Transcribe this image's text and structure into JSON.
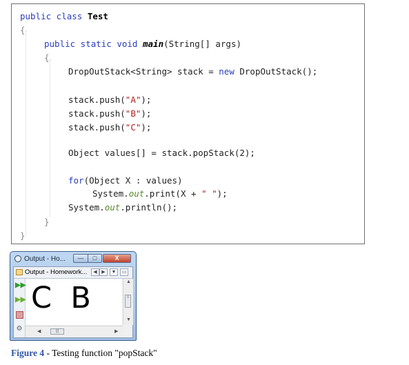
{
  "code": {
    "class_kw": "public class",
    "class_name": "Test",
    "open_brace": "{",
    "close_brace": "}",
    "main_kw": "public static void",
    "main_name": "main",
    "main_params": "(String[] args)",
    "decl_type": "DropOutStack<String> stack",
    "decl_eq": "=",
    "decl_new": "new",
    "decl_ctor": "DropOutStack();",
    "push_call": "stack.push(",
    "push_close": ");",
    "push_a": "\"A\"",
    "push_b": "\"B\"",
    "push_c": "\"C\"",
    "pop_stmt": "Object values[] = stack.popStack(2);",
    "for_kw": "for",
    "for_rest": "(Object X : values)",
    "print_prefix": "System.",
    "print_out": "out",
    "print_call": ".print(X + ",
    "print_str": "\" \"",
    "print_end": ");",
    "println_call": ".println();"
  },
  "output_window": {
    "title": "Output - Ho...",
    "tab_label": "Output - Homework...",
    "output_text": "C  B",
    "minimize_glyph": "—",
    "maximize_glyph": "□",
    "close_glyph": "X",
    "nav_left": "◀",
    "nav_right": "▶",
    "tab_menu_glyph": "▼",
    "tab_restore_glyph": "▭",
    "scroll_up": "▲",
    "scroll_down": "▼",
    "scroll_left": "◀",
    "scroll_right": "▶",
    "grip_v": "≡",
    "grip_h": "|||"
  },
  "caption": {
    "figure_label": "Figure 4",
    "text": " - Testing function \"popStack\""
  },
  "icons": [
    "rerun-icon",
    "rerun-different-params-icon",
    "stop-icon",
    "settings-icon",
    "output-window-icon",
    "output-tab-icon"
  ],
  "colors": {
    "keyword": "#2a3dbe",
    "string": "#b0211c",
    "static_field": "#5a8a2c",
    "figure_label": "#2f56a3",
    "close_button": "#c0402a"
  }
}
